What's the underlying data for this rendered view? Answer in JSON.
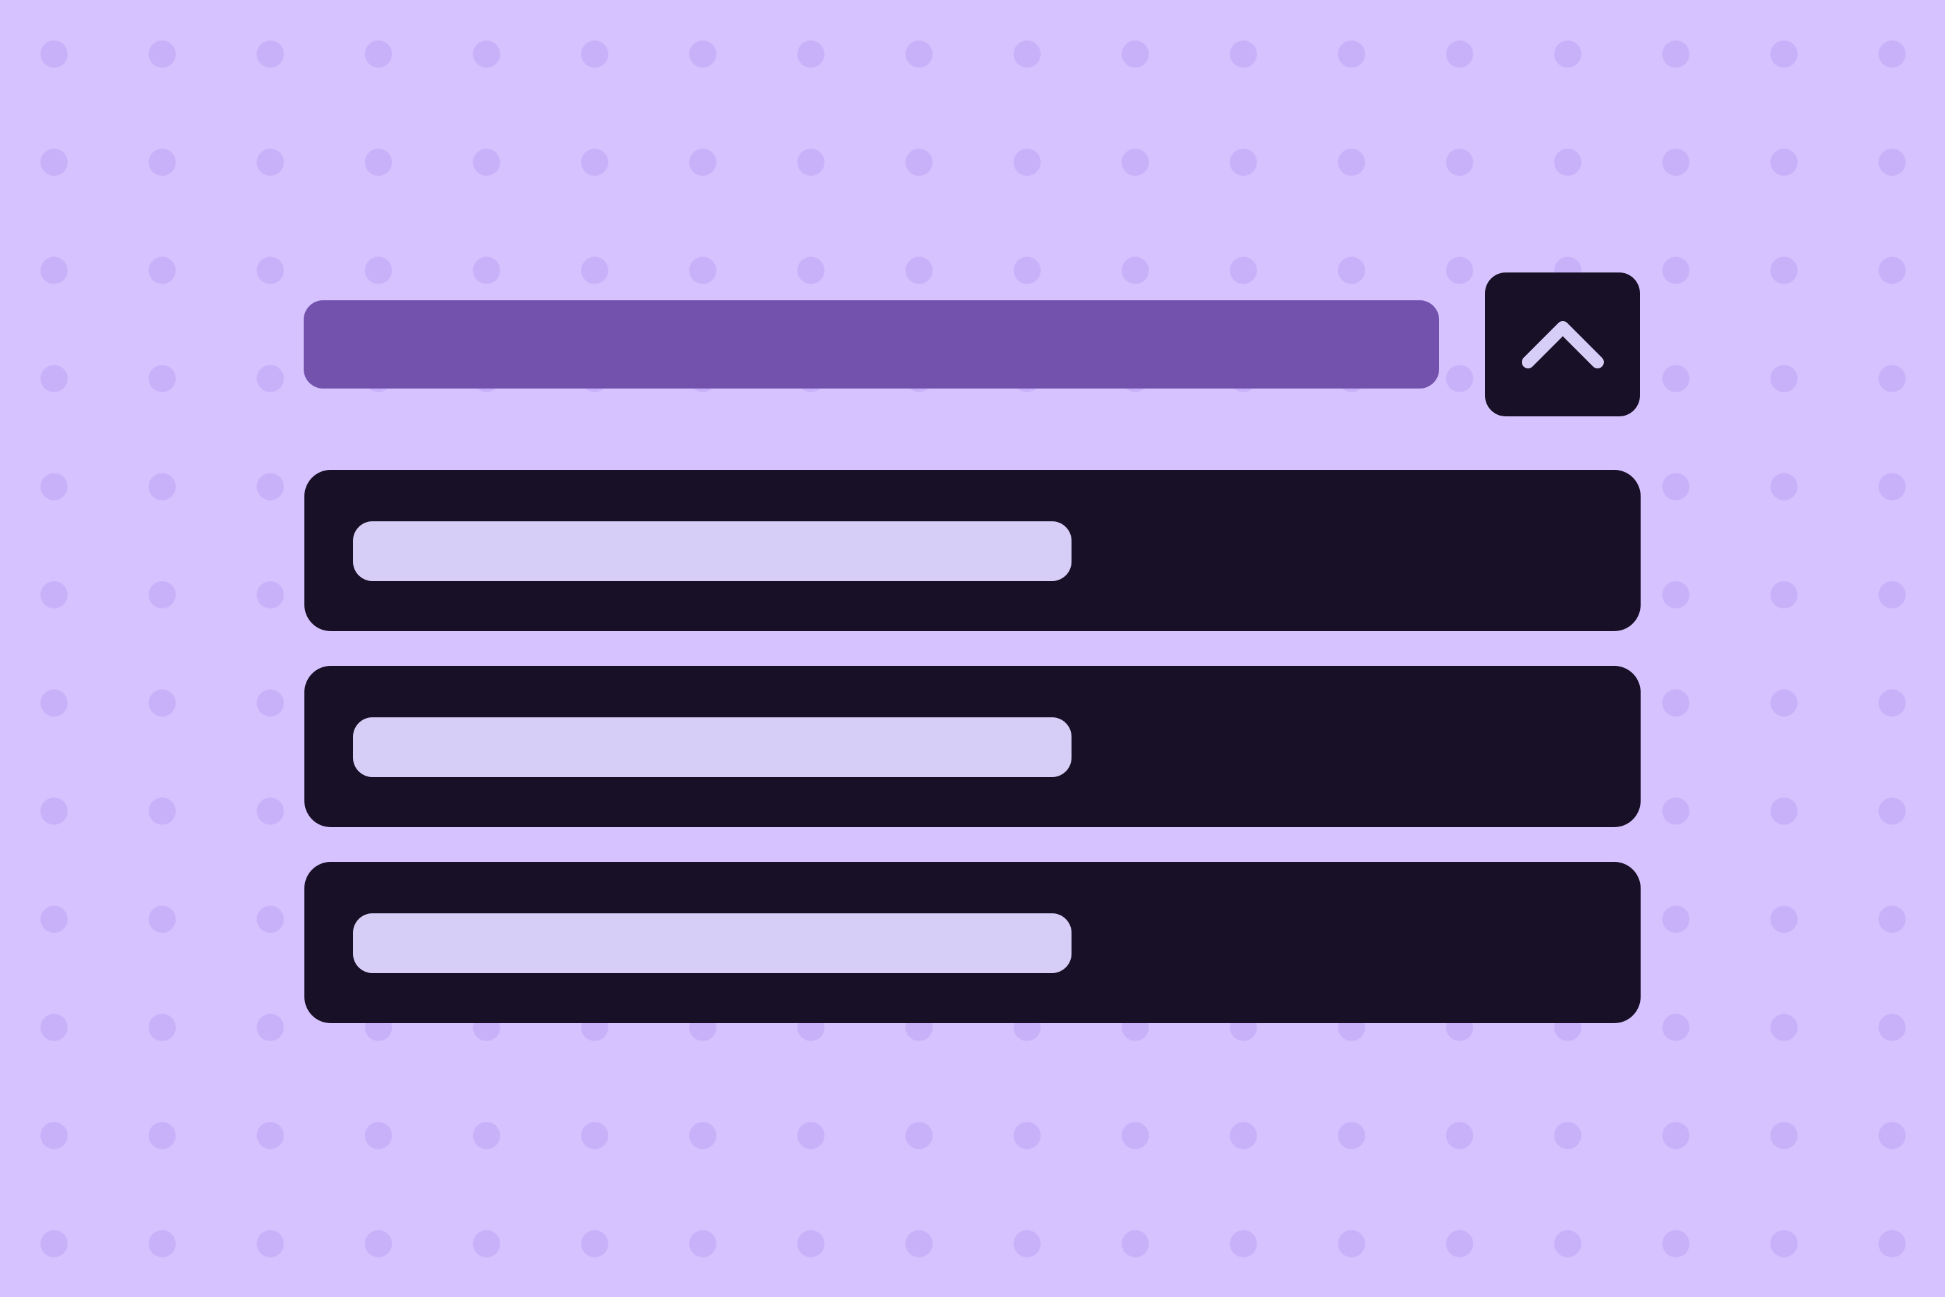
{
  "colors": {
    "background": "#D5C2FE",
    "dot": "#C9B1F9",
    "accent": "#7352AE",
    "dark": "#181026",
    "placeholder": "#D7CEF7"
  },
  "dropdown": {
    "expanded": true,
    "toggle_icon": "chevron-up-icon",
    "options": [
      {
        "label_placeholder": true
      },
      {
        "label_placeholder": true
      },
      {
        "label_placeholder": true
      }
    ]
  }
}
